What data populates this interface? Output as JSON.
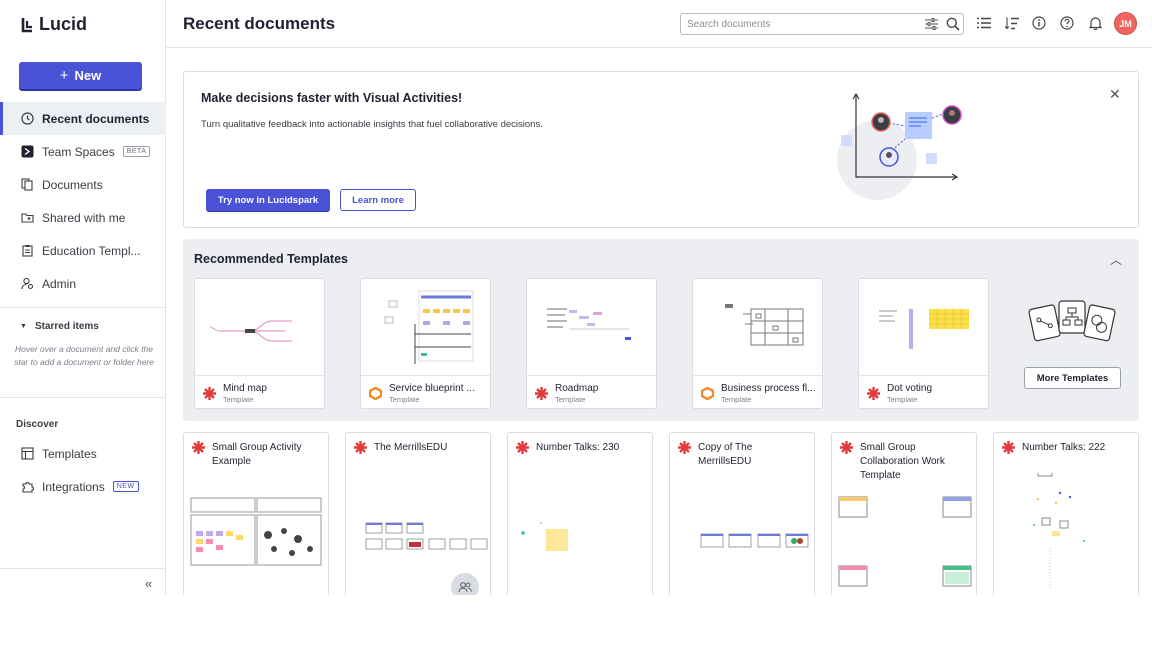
{
  "brand": {
    "name": "Lucid",
    "accent": "#4a52d8",
    "avatar_color": "#f0655f"
  },
  "sidebar": {
    "new_label": "New",
    "items": [
      {
        "label": "Recent documents",
        "icon": "clock-icon",
        "active": true
      },
      {
        "label": "Team Spaces",
        "icon": "team-spaces-icon",
        "badge": "BETA"
      },
      {
        "label": "Documents",
        "icon": "documents-icon"
      },
      {
        "label": "Shared with me",
        "icon": "shared-folder-icon"
      },
      {
        "label": "Education Templ...",
        "icon": "clipboard-icon"
      },
      {
        "label": "Admin",
        "icon": "admin-icon"
      }
    ],
    "starred_title": "Starred items",
    "starred_hint": "Hover over a document and click the star to add a document or folder here",
    "discover_title": "Discover",
    "discover_items": [
      {
        "label": "Templates",
        "icon": "templates-icon"
      },
      {
        "label": "Integrations",
        "icon": "puzzle-icon",
        "badge": "NEW"
      }
    ]
  },
  "header": {
    "title": "Recent documents",
    "search_placeholder": "Search documents",
    "avatar_initials": "JM"
  },
  "banner": {
    "title": "Make decisions faster with Visual Activities!",
    "subtitle": "Turn qualitative feedback into actionable insights that fuel collaborative decisions.",
    "primary_label": "Try now in Lucidspark",
    "secondary_label": "Learn more"
  },
  "templates": {
    "title": "Recommended Templates",
    "more_label": "More Templates",
    "items": [
      {
        "name": "Mind map",
        "kind": "Template",
        "app": "lucidspark"
      },
      {
        "name": "Service blueprint ...",
        "kind": "Template",
        "app": "lucidchart"
      },
      {
        "name": "Roadmap",
        "kind": "Template",
        "app": "lucidspark"
      },
      {
        "name": "Business process fl...",
        "kind": "Template",
        "app": "lucidchart"
      },
      {
        "name": "Dot voting",
        "kind": "Template",
        "app": "lucidspark"
      }
    ]
  },
  "documents": [
    {
      "title": "Small Group Activity Example"
    },
    {
      "title": "The MerrillsEDU"
    },
    {
      "title": "Number Talks: 230"
    },
    {
      "title": "Copy of The MerrillsEDU"
    },
    {
      "title": "Small Group Collaboration Work Template"
    },
    {
      "title": "Number Talks: 222"
    }
  ]
}
